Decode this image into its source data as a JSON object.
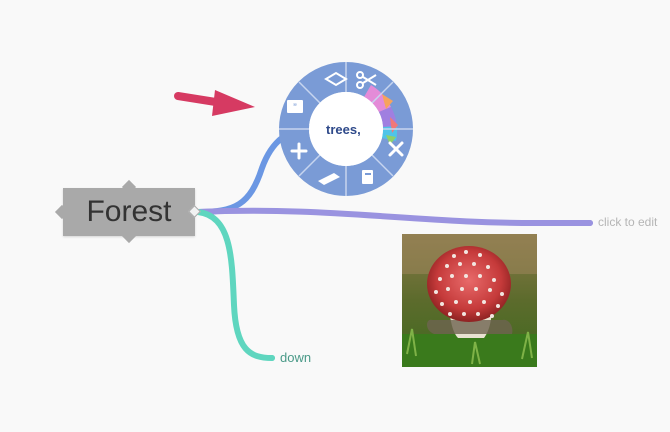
{
  "central_node": {
    "label": "Forest"
  },
  "nodes": [
    {
      "id": "trees",
      "label": "trees"
    },
    {
      "id": "edit",
      "label": "click to edit"
    },
    {
      "id": "down",
      "label": "down"
    }
  ],
  "radial_menu": {
    "items": [
      {
        "name": "shape-diamond-icon"
      },
      {
        "name": "scissors-icon"
      },
      {
        "name": "color-picker-icon"
      },
      {
        "name": "delete-icon"
      },
      {
        "name": "paste-icon"
      },
      {
        "name": "attachment-icon"
      },
      {
        "name": "add-icon"
      },
      {
        "name": "quote-icon"
      }
    ]
  },
  "colors": {
    "background": "#f9f9f9",
    "central_node": "#a9a9a9",
    "branch_trees": "#6b97e3",
    "branch_edit": "#9a93e0",
    "branch_down": "#5fd6bf",
    "menu_ring": "#7a9bd6",
    "arrow": "#d63a62"
  },
  "image": {
    "name": "fly-agaric-mushroom-photo"
  }
}
